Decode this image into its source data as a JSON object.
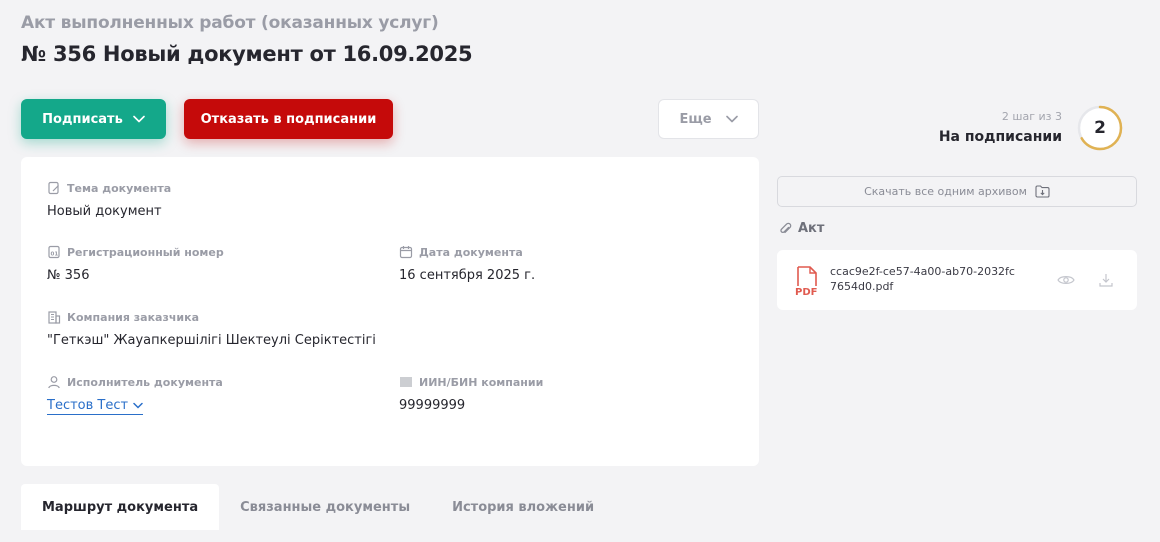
{
  "header": {
    "subtitle": "Акт выполненных работ (оказанных услуг)",
    "title": "№ 356 Новый документ от 16.09.2025"
  },
  "actions": {
    "sign_label": "Подписать",
    "reject_label": "Отказать в подписании",
    "more_label": "Еще"
  },
  "status": {
    "step_count": "2 шаг из 3",
    "step_label": "На подписании",
    "step_number": "2",
    "progress": 0.667,
    "accent": "#e0b253"
  },
  "document": {
    "topic_label": "Тема документа",
    "topic_value": "Новый документ",
    "reg_label": "Регистрационный номер",
    "reg_value": "№ 356",
    "date_label": "Дата документа",
    "date_value": "16 сентября 2025 г.",
    "company_label": "Компания заказчика",
    "company_value": "\"Геткэш\" Жауапкершілігі Шектеулі Серіктестігі",
    "executor_label": "Исполнитель документа",
    "executor_value": "Тестов Тест",
    "iin_label": "ИИН/БИН компании",
    "iin_value": "99999999"
  },
  "attachments": {
    "archive_label": "Скачать все одним архивом",
    "section_label": "Акт",
    "file_name": "ccac9e2f-ce57-4a00-ab70-2032fc7654d0.pdf",
    "file_type": "PDF"
  },
  "tabs": [
    {
      "label": "Маршрут документа",
      "active": true
    },
    {
      "label": "Связанные документы",
      "active": false
    },
    {
      "label": "История вложений",
      "active": false
    }
  ],
  "colors": {
    "primary": "#14a88a",
    "danger": "#c50a0a",
    "link": "#2a6fc9",
    "pdf": "#e05a4f"
  }
}
